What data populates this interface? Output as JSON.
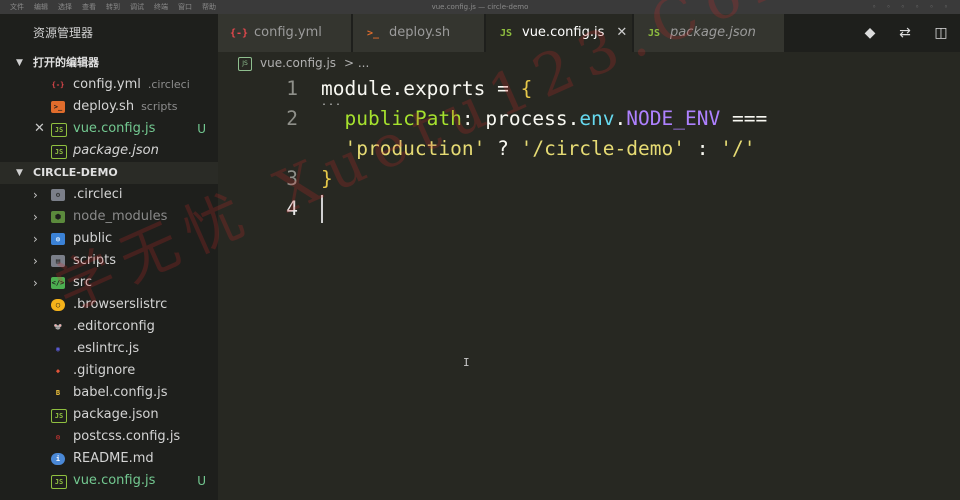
{
  "menubar": {
    "menus": [
      "文件",
      "编辑",
      "选择",
      "查看",
      "转到",
      "调试",
      "终端",
      "窗口",
      "帮助"
    ],
    "window_title": "vue.config.js — circle-demo"
  },
  "sidebar": {
    "title": "资源管理器",
    "open_editors": {
      "label": "打开的编辑器",
      "items": [
        {
          "name": "config.yml",
          "desc": ".circleci",
          "icon": "yaml-icon",
          "badge": "",
          "active": false,
          "italic": false
        },
        {
          "name": "deploy.sh",
          "desc": "scripts",
          "icon": "shell-icon",
          "badge": "",
          "active": false,
          "italic": false
        },
        {
          "name": "vue.config.js",
          "desc": "",
          "icon": "js-icon",
          "badge": "U",
          "active": true,
          "italic": false
        },
        {
          "name": "package.json",
          "desc": "",
          "icon": "json-icon",
          "badge": "",
          "active": false,
          "italic": true
        }
      ]
    },
    "project": {
      "label": "CIRCLE-DEMO",
      "items": [
        {
          "name": ".circleci",
          "type": "folder",
          "icon": "folder-icon",
          "badge": ""
        },
        {
          "name": "node_modules",
          "type": "folder",
          "icon": "folder-node-icon",
          "badge": ""
        },
        {
          "name": "public",
          "type": "folder",
          "icon": "folder-public-icon",
          "badge": ""
        },
        {
          "name": "scripts",
          "type": "folder",
          "icon": "folder-scripts-icon",
          "badge": ""
        },
        {
          "name": "src",
          "type": "folder",
          "icon": "folder-src-icon",
          "badge": ""
        },
        {
          "name": ".browserslistrc",
          "type": "file",
          "icon": "browserslist-icon",
          "badge": ""
        },
        {
          "name": ".editorconfig",
          "type": "file",
          "icon": "editorconfig-icon",
          "badge": ""
        },
        {
          "name": ".eslintrc.js",
          "type": "file",
          "icon": "eslint-icon",
          "badge": ""
        },
        {
          "name": ".gitignore",
          "type": "file",
          "icon": "git-icon",
          "badge": ""
        },
        {
          "name": "babel.config.js",
          "type": "file",
          "icon": "babel-icon",
          "badge": ""
        },
        {
          "name": "package.json",
          "type": "file",
          "icon": "json-icon",
          "badge": ""
        },
        {
          "name": "postcss.config.js",
          "type": "file",
          "icon": "postcss-icon",
          "badge": ""
        },
        {
          "name": "README.md",
          "type": "file",
          "icon": "readme-icon",
          "badge": ""
        },
        {
          "name": "vue.config.js",
          "type": "file",
          "icon": "js-icon",
          "badge": "U"
        }
      ]
    }
  },
  "tabs": [
    {
      "label": "config.yml",
      "icon": "yaml-icon",
      "active": false,
      "italic": false
    },
    {
      "label": "deploy.sh",
      "icon": "shell-icon",
      "active": false,
      "italic": false
    },
    {
      "label": "vue.config.js",
      "icon": "js-icon",
      "active": true,
      "italic": false
    },
    {
      "label": "package.json",
      "icon": "json-icon",
      "active": false,
      "italic": true
    }
  ],
  "tab_actions": [
    "git-compare-icon",
    "open-changes-icon",
    "split-editor-icon"
  ],
  "breadcrumb": {
    "file": "vue.config.js",
    "sep": "> ..."
  },
  "editor": {
    "lines": [
      {
        "number": "1",
        "tokens": [
          [
            "module",
            "t-plain"
          ],
          [
            ".",
            "t-op"
          ],
          [
            "exports",
            "t-plain"
          ],
          [
            " = ",
            "t-op"
          ],
          [
            "{",
            "t-brace"
          ]
        ]
      },
      {
        "number": "2",
        "tokens": [
          [
            "  ",
            "t-plain"
          ],
          [
            "publicPath",
            "t-prop"
          ],
          [
            ": ",
            "t-op"
          ],
          [
            "process",
            "t-obj"
          ],
          [
            ".",
            "t-op"
          ],
          [
            "env",
            "t-env"
          ],
          [
            ".",
            "t-op"
          ],
          [
            "NODE_ENV",
            "t-const"
          ],
          [
            " === ",
            "t-op"
          ]
        ]
      },
      {
        "number": "",
        "tokens": [
          [
            "  ",
            "t-plain"
          ],
          [
            "'production'",
            "t-str"
          ],
          [
            " ? ",
            "t-op"
          ],
          [
            "'/circle-demo'",
            "t-str"
          ],
          [
            " : ",
            "t-op"
          ],
          [
            "'/'",
            "t-str"
          ]
        ]
      },
      {
        "number": "3",
        "tokens": [
          [
            "}",
            "t-brace"
          ]
        ]
      },
      {
        "number": "4",
        "tokens": []
      }
    ],
    "fold_dots": "..."
  },
  "watermark": "学无忧  Xuetu123.Com",
  "colors": {
    "editor_bg": "#272822",
    "sidebar_bg": "#1e1f1c",
    "untracked": "#73c991",
    "string": "#e6db74",
    "property": "#a6e22e"
  }
}
